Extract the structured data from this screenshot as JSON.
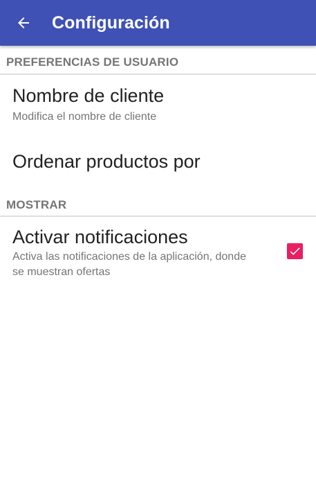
{
  "appbar": {
    "title": "Configuración",
    "back_icon": "arrow-back-icon",
    "color": "#3F51B5"
  },
  "categories": [
    {
      "label": "PREFERENCIAS DE USUARIO",
      "items": [
        {
          "title": "Nombre de cliente",
          "summary": "Modifica el nombre de cliente"
        },
        {
          "title": "Ordenar productos por"
        }
      ]
    },
    {
      "label": "MOSTRAR",
      "items": [
        {
          "title": "Activar notificaciones",
          "summary_line1": "Activa las notificaciones de la aplicación, donde",
          "summary_line2": "se muestran ofertas",
          "checked": true,
          "checkbox_icon": "check-icon",
          "accent": "#E91E63"
        }
      ]
    }
  ]
}
